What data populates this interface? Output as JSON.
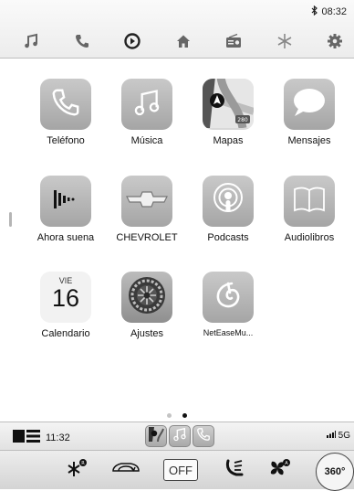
{
  "status": {
    "bluetooth_icon": "bluetooth-icon",
    "time": "08:32"
  },
  "top_icons": [
    "music-note-icon",
    "phone-icon",
    "carplay-play-icon",
    "home-icon",
    "radio-icon",
    "snowflake-icon",
    "gear-icon"
  ],
  "apps": [
    {
      "label": "Teléfono",
      "icon": "phone-icon"
    },
    {
      "label": "Música",
      "icon": "music-note-icon"
    },
    {
      "label": "Mapas",
      "icon": "maps-icon",
      "badge": "280"
    },
    {
      "label": "Mensajes",
      "icon": "speech-bubble-icon"
    },
    {
      "label": "Ahora suena",
      "icon": "now-playing-icon"
    },
    {
      "label": "CHEVROLET",
      "icon": "chevrolet-bowtie-icon"
    },
    {
      "label": "Podcasts",
      "icon": "podcasts-icon"
    },
    {
      "label": "Audiolibros",
      "icon": "open-book-icon"
    },
    {
      "label": "Calendario",
      "icon": "calendar-icon",
      "weekday": "VIE",
      "day": "16"
    },
    {
      "label": "Ajustes",
      "icon": "settings-gear-icon"
    },
    {
      "label": "NetEaseMu...",
      "icon": "netease-music-icon"
    }
  ],
  "page_indicator": {
    "pages": 2,
    "current": 2
  },
  "dock": {
    "time": "11:32",
    "network": "5G",
    "recent_apps": [
      "maps-icon",
      "music-note-icon",
      "phone-icon"
    ]
  },
  "climate": {
    "off_label": "OFF",
    "view_360_label": "360°",
    "icons": [
      "rear-defrost-icon",
      "recirculation-icon",
      "seat-airflow-icon",
      "fan-icon"
    ]
  }
}
